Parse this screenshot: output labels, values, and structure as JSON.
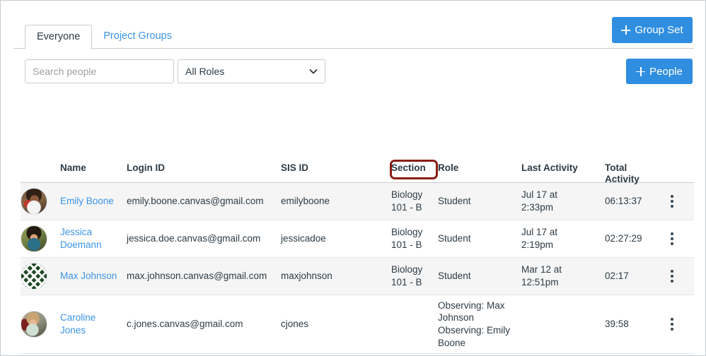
{
  "tabs": [
    {
      "label": "Everyone",
      "active": true
    },
    {
      "label": "Project Groups",
      "active": false
    }
  ],
  "toolbar": {
    "group_set_button": "Group Set",
    "people_button": "People",
    "add_icon": "plus-icon"
  },
  "filters": {
    "search_placeholder": "Search people",
    "search_value": "",
    "role_filter_value": "All Roles",
    "role_filter_icon": "chevron-down-icon"
  },
  "table": {
    "columns": [
      "Name",
      "Login ID",
      "SIS ID",
      "Section",
      "Role",
      "Last Activity",
      "Total\nActivity"
    ],
    "rows": [
      {
        "avatar": "photo-avatar-emily",
        "name": "Emily Boone",
        "login_id": "emily.boone.canvas@gmail.com",
        "sis_id": "emilyboone",
        "section": "Biology\n101 - B",
        "role": "Student",
        "last_activity": "Jul 17 at\n2:33pm",
        "total_activity": "06:13:37",
        "menu_icon": "kebab-menu-icon"
      },
      {
        "avatar": "photo-avatar-jessica",
        "name": "Jessica Doemann",
        "login_id": "jessica.doe.canvas@gmail.com",
        "sis_id": "jessicadoe",
        "section": "Biology\n101 - B",
        "role": "Student",
        "last_activity": "Jul 17 at\n2:19pm",
        "total_activity": "02:27:29",
        "menu_icon": "kebab-menu-icon"
      },
      {
        "avatar": "identicon-avatar-max",
        "name": "Max Johnson",
        "login_id": "max.johnson.canvas@gmail.com",
        "sis_id": "maxjohnson",
        "section": "Biology\n101 - B",
        "role": "Student",
        "last_activity": "Mar 12 at\n12:51pm",
        "total_activity": "02:17",
        "menu_icon": "kebab-menu-icon"
      },
      {
        "avatar": "photo-avatar-caroline",
        "name": "Caroline Jones",
        "login_id": "c.jones.canvas@gmail.com",
        "sis_id": "cjones",
        "section": "",
        "role": "Observing: Max Johnson\nObserving: Emily Boone",
        "last_activity": "",
        "total_activity": "39:58",
        "menu_icon": "kebab-menu-icon"
      }
    ]
  },
  "annotation": {
    "target": "Section",
    "color": "#8a1c14"
  },
  "colors": {
    "accent_blue": "#2f8ee0",
    "link_blue": "#3b94e6",
    "text": "#2d3b45",
    "row_alt": "#f5f5f5",
    "border": "#c7cdd1"
  }
}
